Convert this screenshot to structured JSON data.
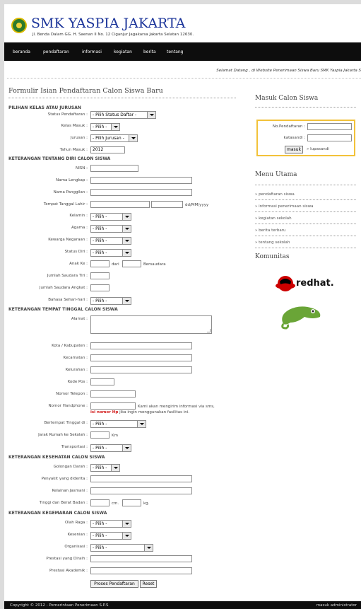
{
  "header": {
    "title": "SMK YASPIA JAKARTA",
    "address": "Jl. Benda Dalam GG. H. Saenan II No. 12 Ciganjur Jagakarsa Jakarta Selatan 12630."
  },
  "nav": [
    "beranda",
    "pendaftaran",
    "informasi",
    "kegiatan",
    "berita",
    "tentang"
  ],
  "welcome": "Selamat Datang , di Website Penerimaan Siswa Baru SMK Yaspia Jakarta S",
  "form": {
    "title": "Formulir Isian Pendaftaran Calon Siswa Baru",
    "sections": {
      "kelas": "PILIHAN KELAS ATAU JURUSAN",
      "diri": "KETERANGAN TENTANG DIRI CALON SISWA",
      "tinggal": "KETERANGAN TEMPAT TINGGAL CALON SISWA",
      "kesehatan": "KETERANGAN KESEHATAN CALON SISWA",
      "kegemaran": "KETERANGAN KEGEMARAN CALON SISWA"
    },
    "labels": {
      "status": "Status Pendaftaran :",
      "kelas": "Kelas Masuk :",
      "jurusan": "Jurusan :",
      "tahun": "Tahun Masuk :",
      "nisn": "NISN :",
      "nama_lengkap": "Nama Lengkap :",
      "nama_panggilan": "Nama Panggilan :",
      "ttl": "Tempat Tanggal Lahir :",
      "kelamin": "Kelamin :",
      "agama": "Agama :",
      "warga": "Kewarga Negaraan :",
      "status_diri": "Status Diri :",
      "anak_ke": "Anak Ke :",
      "saudara_tiri": "Jumlah Saudara Tiri :",
      "saudara_angkat": "Jumlah Saudara Angkat :",
      "bahasa": "Bahasa Sehari-hari :",
      "alamat": "Alamat :",
      "kota": "Kota / Kabupaten :",
      "kecamatan": "Kecamatan :",
      "kelurahan": "Kelurahan :",
      "kodepos": "Kode Pos :",
      "telepon": "Nomor Telepon :",
      "hp": "Nomor Handphone :",
      "bertempat": "Bertempat Tinggal di :",
      "jarak": "Jarak Rumah ke Sekolah :",
      "transportasi": "Transportasi :",
      "darah": "Golongan Darah :",
      "penyakit": "Penyakit yang diderita :",
      "jasmani": "Kelainan Jasmani :",
      "tinggi_berat": "Tinggi dan Berat Badan :",
      "olahraga": "Olah Raga :",
      "kesenian": "Kesenian :",
      "organisasi": "Organisasi :",
      "prestasi_diraih": "Prestasi yang Diraih :",
      "prestasi_akademik": "Prestasi Akademik :"
    },
    "selects": {
      "status": "- Pilih Status Daftar -",
      "pilih": "- Pilih -",
      "jurusan": "- Pilih Jurusan -"
    },
    "values": {
      "tahun": "2012"
    },
    "notes": {
      "date_format": "dd/MM/yyyy",
      "dari": "dari",
      "bersaudara": "Bersaudara",
      "hp_line1": "Kami akan mengirim informasi via sms,",
      "hp_red": "isi nomor Hp",
      "hp_line2": " jika ingin menggunakan fasilitas ini.",
      "km": "Km",
      "cm": "cm.",
      "kg": "kg."
    },
    "buttons": {
      "submit": "Proses Pendaftaran",
      "reset": "Reset"
    }
  },
  "sidebar": {
    "login_title": "Masuk Calon Siswa",
    "login_no": "No.Pendaftaran :",
    "login_pass": "katasandi :",
    "login_btn": "masuk",
    "forgot": "lupasandi",
    "menu_title": "Menu Utama",
    "menu": [
      "pendaftaran siswa",
      "informasi penerimaan siswa",
      "kegiatan sekolah",
      "berita terbaru",
      "tentang sekolah"
    ],
    "komunitas_title": "Komunitas",
    "redhat": "redhat."
  },
  "footer": {
    "left": "Copyright © 2012 - Pemerintaan Penerimaan S.P.S",
    "right": "masuk administrator"
  }
}
